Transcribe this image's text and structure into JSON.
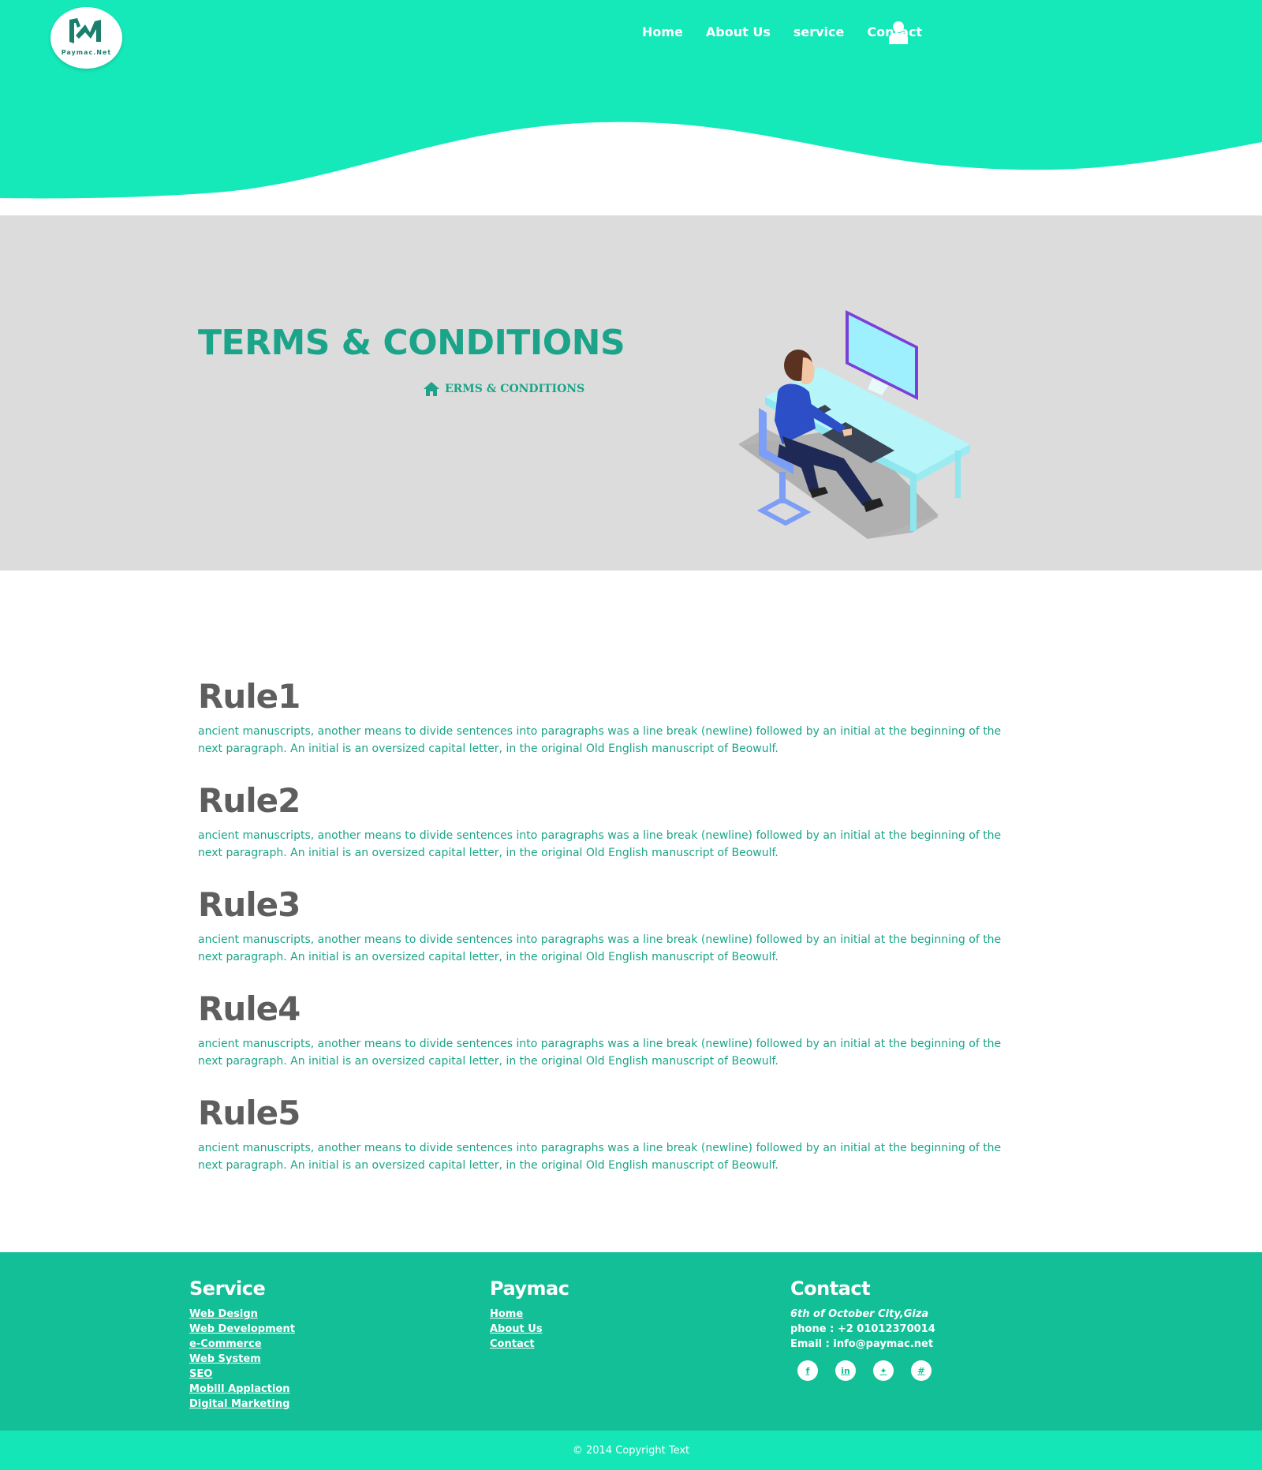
{
  "colors": {
    "header_teal": "#15e8b9",
    "accent_green": "#1ba489",
    "footer_green": "#13bf96",
    "banner_gray": "#dcdcdc",
    "rule_heading": "#5e5e5e"
  },
  "logo": {
    "text": "Paymac.Net"
  },
  "nav": {
    "items": [
      {
        "label": "Home"
      },
      {
        "label": "About Us"
      },
      {
        "label": "service"
      },
      {
        "label": "Contact"
      }
    ],
    "user_icon": "user-icon"
  },
  "banner": {
    "title": "TERMS & CONDITIONS",
    "breadcrumb_icon": "home-icon",
    "breadcrumb": "ERMS & CONDITIONS"
  },
  "rules": [
    {
      "title": "Rule1",
      "text": "ancient manuscripts, another means to divide sentences into paragraphs was a line break (newline) followed by an initial at the beginning of the next paragraph. An initial is an oversized capital letter, in the original Old English manuscript of Beowulf."
    },
    {
      "title": "Rule2",
      "text": "ancient manuscripts, another means to divide sentences into paragraphs was a line break (newline) followed by an initial at the beginning of the next paragraph. An initial is an oversized capital letter, in the original Old English manuscript of Beowulf."
    },
    {
      "title": "Rule3",
      "text": "ancient manuscripts, another means to divide sentences into paragraphs was a line break (newline) followed by an initial at the beginning of the next paragraph. An initial is an oversized capital letter, in the original Old English manuscript of Beowulf."
    },
    {
      "title": "Rule4",
      "text": "ancient manuscripts, another means to divide sentences into paragraphs was a line break (newline) followed by an initial at the beginning of the next paragraph. An initial is an oversized capital letter, in the original Old English manuscript of Beowulf."
    },
    {
      "title": "Rule5",
      "text": "ancient manuscripts, another means to divide sentences into paragraphs was a line break (newline) followed by an initial at the beginning of the next paragraph. An initial is an oversized capital letter, in the original Old English manuscript of Beowulf."
    }
  ],
  "footer": {
    "service": {
      "title": "Service",
      "items": [
        "Web Design",
        "Web Development",
        "e-Commerce",
        "Web System",
        "SEO",
        "Mobill Applaction",
        "Digital Marketing"
      ]
    },
    "paymac": {
      "title": "Paymac",
      "items": [
        "Home",
        "About Us",
        "Contact"
      ]
    },
    "contact": {
      "title": "Contact",
      "address": "6th of October City,Giza",
      "phone": "phone : +2 01012370014",
      "email": "Email : info@paymac.net",
      "socials": [
        {
          "icon": "facebook-icon",
          "glyph": "f"
        },
        {
          "icon": "linkedin-icon",
          "glyph": "in"
        },
        {
          "icon": "twitter-icon",
          "glyph": "✦"
        },
        {
          "icon": "slack-icon",
          "glyph": "#"
        }
      ]
    },
    "copyright": "© 2014 Copyright Text"
  }
}
